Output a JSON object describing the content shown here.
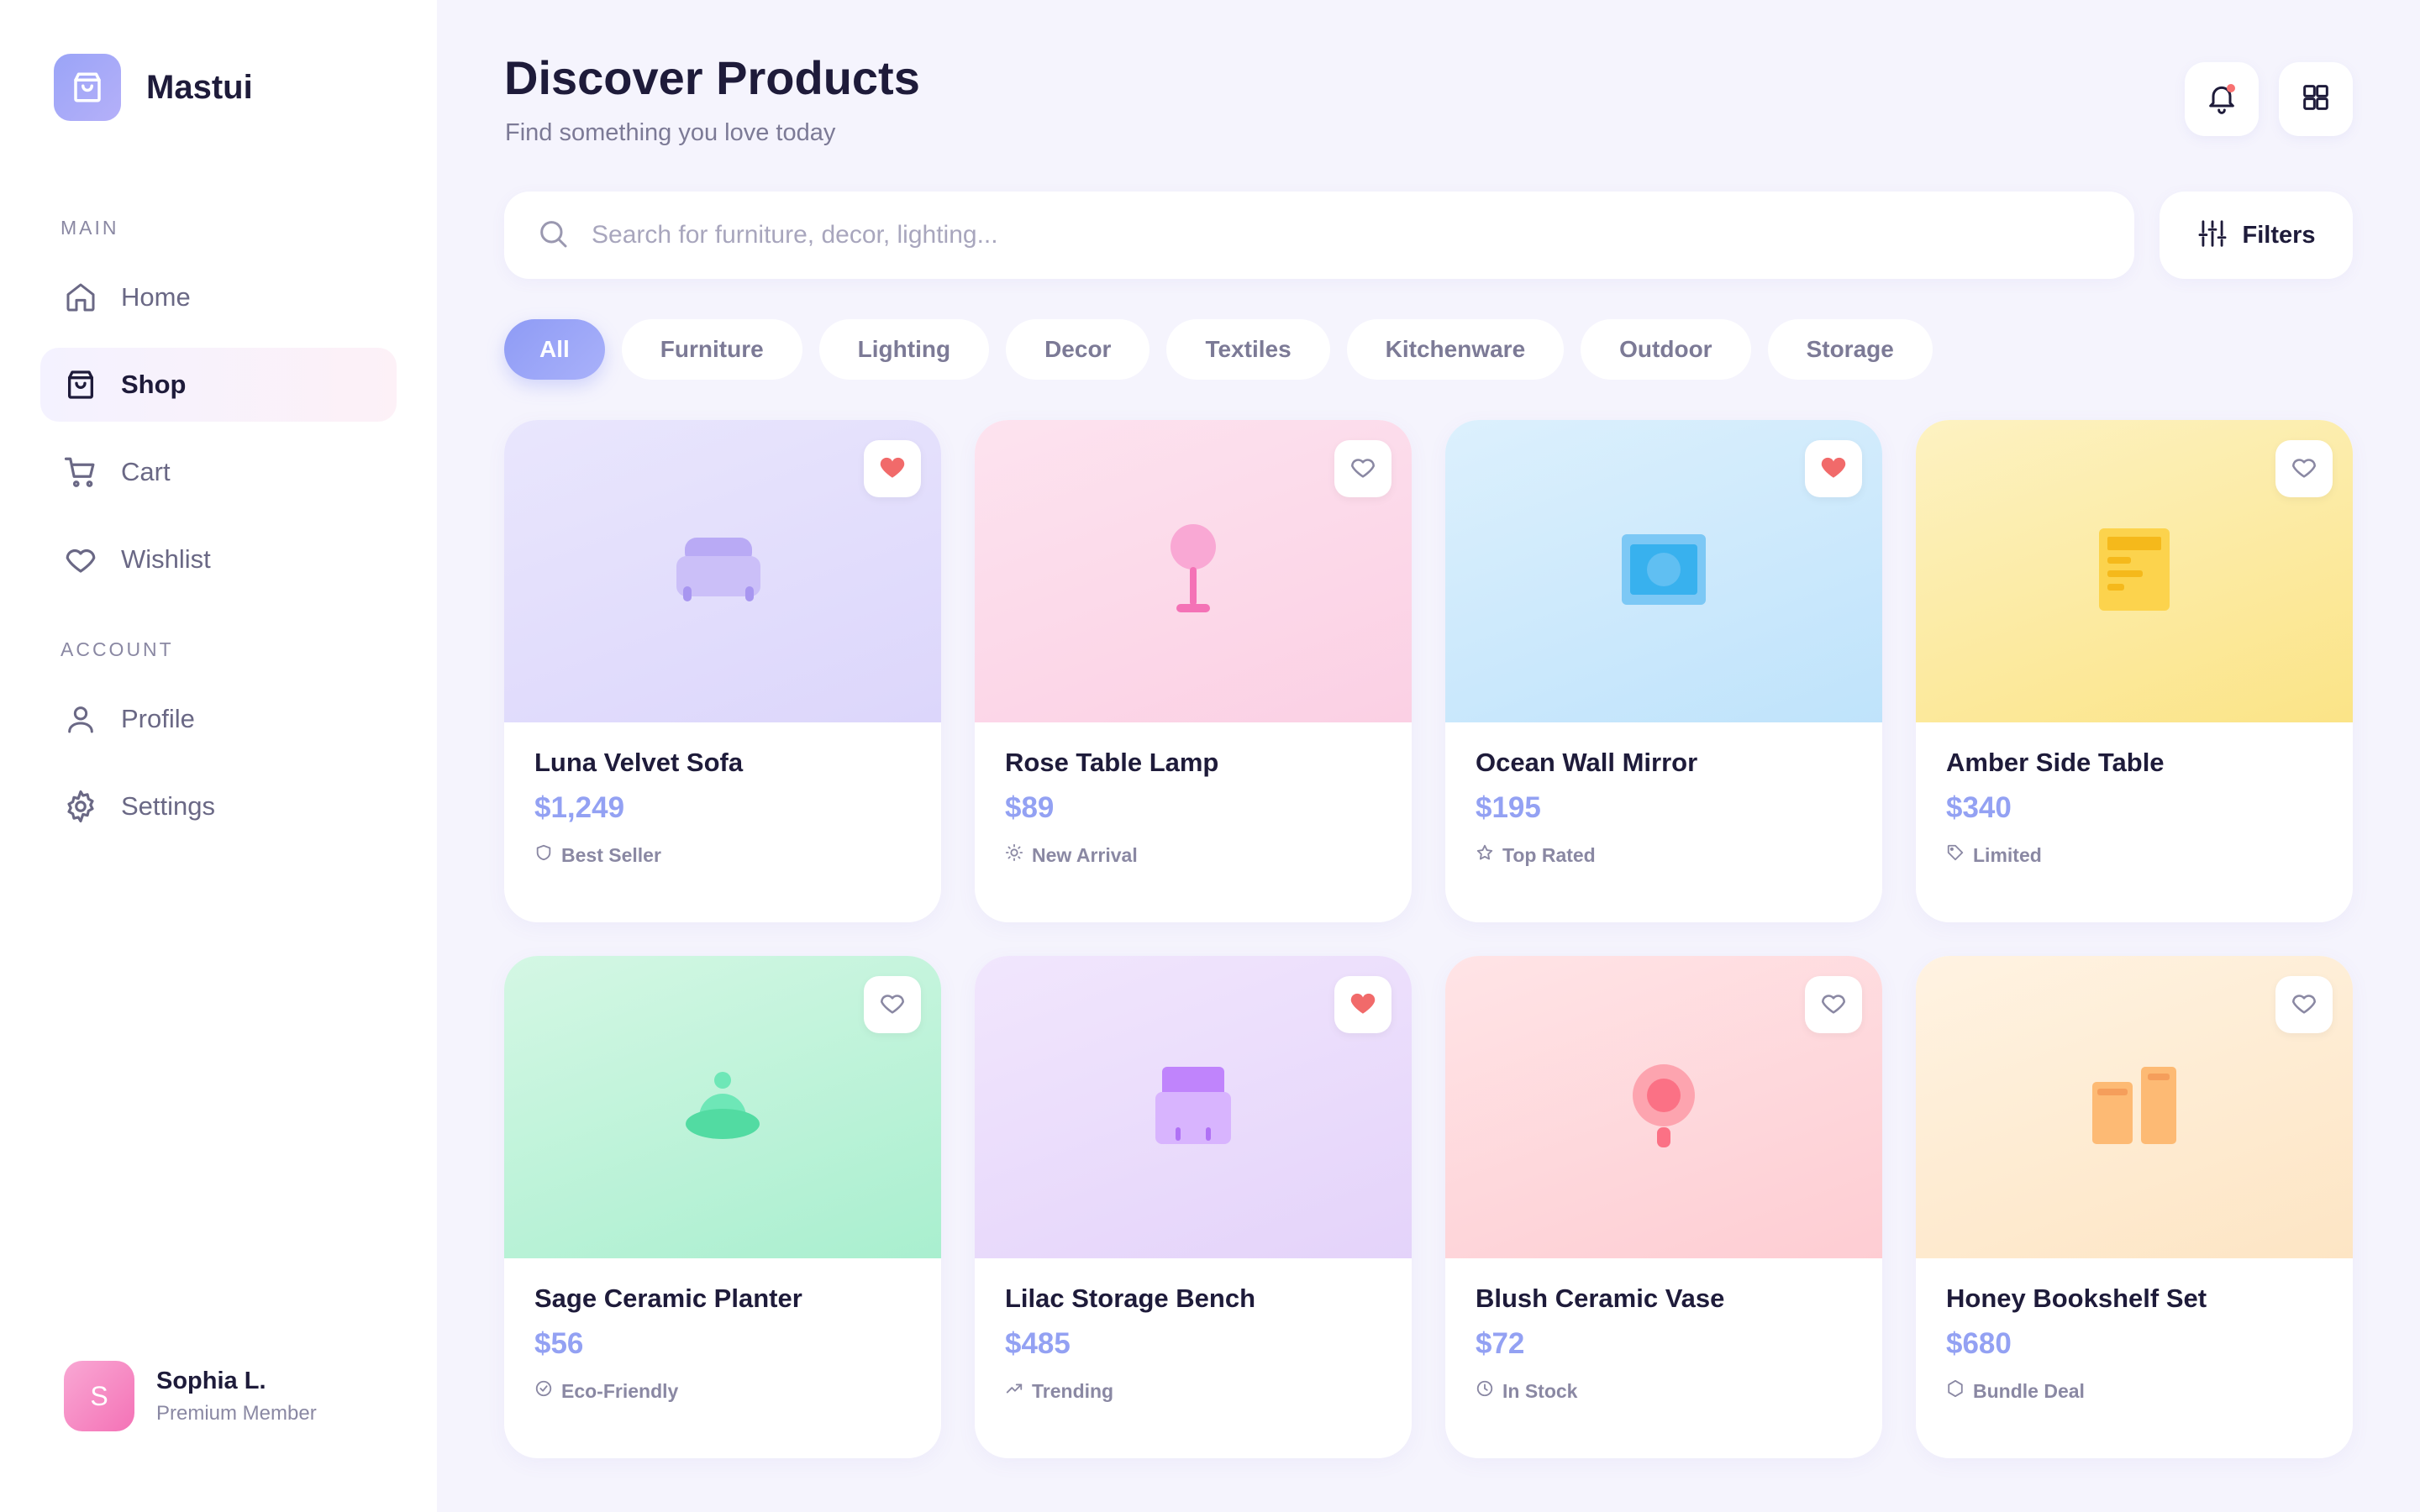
{
  "app": {
    "name": "Mastui"
  },
  "sidebar": {
    "main_label": "MAIN",
    "account_label": "ACCOUNT",
    "main_items": [
      {
        "label": "Home",
        "icon": "home-icon"
      },
      {
        "label": "Shop",
        "icon": "shopping-bag-icon",
        "active": true
      },
      {
        "label": "Cart",
        "icon": "cart-icon"
      },
      {
        "label": "Wishlist",
        "icon": "heart-icon"
      }
    ],
    "account_items": [
      {
        "label": "Profile",
        "icon": "user-icon"
      },
      {
        "label": "Settings",
        "icon": "gear-icon"
      }
    ]
  },
  "user": {
    "initial": "S",
    "name": "Sophia L.",
    "role": "Premium Member"
  },
  "header": {
    "title": "Discover Products",
    "subtitle": "Find something you love today"
  },
  "search": {
    "placeholder": "Search for furniture, decor, lighting...",
    "value": ""
  },
  "filters": {
    "label": "Filters"
  },
  "categories": [
    {
      "label": "All",
      "active": true
    },
    {
      "label": "Furniture"
    },
    {
      "label": "Lighting"
    },
    {
      "label": "Decor"
    },
    {
      "label": "Textiles"
    },
    {
      "label": "Kitchenware"
    },
    {
      "label": "Outdoor"
    },
    {
      "label": "Storage"
    }
  ],
  "colors": {
    "accent": "#93a1f3",
    "heart_active": "#f16a6a",
    "notification": "#f87171"
  },
  "products": [
    {
      "name": "Luna Velvet Sofa",
      "price": "$1,249",
      "badge": "Best Seller",
      "badge_icon": "shield-icon",
      "favorite": true,
      "illustration": "sofa-icon",
      "bg": [
        "#e9e6fd",
        "#dcd6fb"
      ]
    },
    {
      "name": "Rose Table Lamp",
      "price": "$89",
      "badge": "New Arrival",
      "badge_icon": "sun-icon",
      "favorite": false,
      "illustration": "lamp-icon",
      "bg": [
        "#fde3ef",
        "#fbd0e4"
      ]
    },
    {
      "name": "Ocean Wall Mirror",
      "price": "$195",
      "badge": "Top Rated",
      "badge_icon": "star-icon",
      "favorite": true,
      "illustration": "mirror-icon",
      "bg": [
        "#dcf0fd",
        "#bfe3fb"
      ]
    },
    {
      "name": "Amber Side Table",
      "price": "$340",
      "badge": "Limited",
      "badge_icon": "tag-icon",
      "favorite": false,
      "illustration": "table-icon",
      "bg": [
        "#fdf2c2",
        "#fbe487"
      ]
    },
    {
      "name": "Sage Ceramic Planter",
      "price": "$56",
      "badge": "Eco-Friendly",
      "badge_icon": "check-circle-icon",
      "favorite": false,
      "illustration": "planter-icon",
      "bg": [
        "#d4f7e4",
        "#a9efcf"
      ]
    },
    {
      "name": "Lilac Storage Bench",
      "price": "$485",
      "badge": "Trending",
      "badge_icon": "trend-up-icon",
      "favorite": true,
      "illustration": "bench-icon",
      "bg": [
        "#f1e6fd",
        "#e4d3fa"
      ]
    },
    {
      "name": "Blush Ceramic Vase",
      "price": "$72",
      "badge": "In Stock",
      "badge_icon": "clock-icon",
      "favorite": false,
      "illustration": "vase-icon",
      "bg": [
        "#ffe4e6",
        "#fecdd3"
      ]
    },
    {
      "name": "Honey Bookshelf Set",
      "price": "$680",
      "badge": "Bundle Deal",
      "badge_icon": "hexagon-icon",
      "favorite": false,
      "illustration": "books-icon",
      "bg": [
        "#fff3e2",
        "#fde5c4"
      ]
    }
  ]
}
